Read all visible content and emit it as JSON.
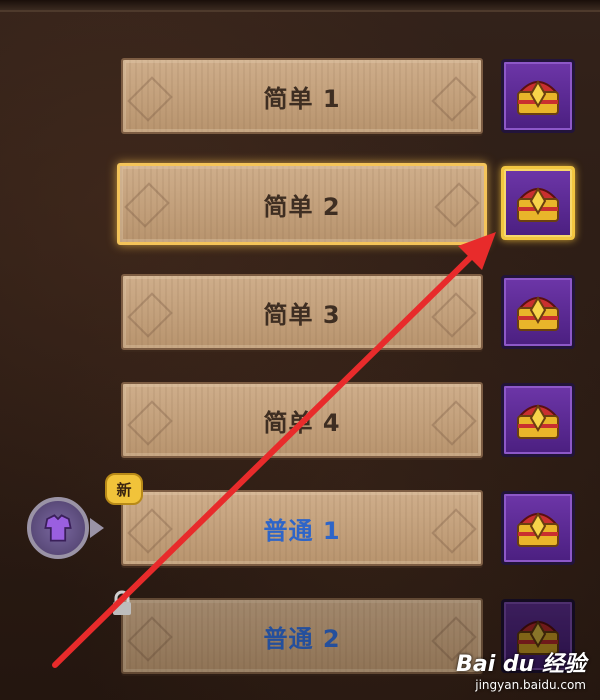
{
  "levels": [
    {
      "label": "简单 1",
      "state": "normal"
    },
    {
      "label": "简单 2",
      "state": "selected"
    },
    {
      "label": "简单 3",
      "state": "normal"
    },
    {
      "label": "简单 4",
      "state": "normal"
    },
    {
      "label": "普通 1",
      "state": "new"
    },
    {
      "label": "普通 2",
      "state": "locked"
    }
  ],
  "badge": {
    "new_label": "新"
  },
  "icons": {
    "chest": "treasure-chest-icon",
    "avatar": "armor-icon",
    "lock": "lock-icon"
  },
  "colors": {
    "accent_selected": "#f4c45a",
    "chest_bg": "#5a2a92",
    "arrow": "#e82b2b",
    "normal_text": "#2e65c8"
  },
  "watermark": {
    "logo": "Bai du 经验",
    "url": "jingyan.baidu.com"
  }
}
